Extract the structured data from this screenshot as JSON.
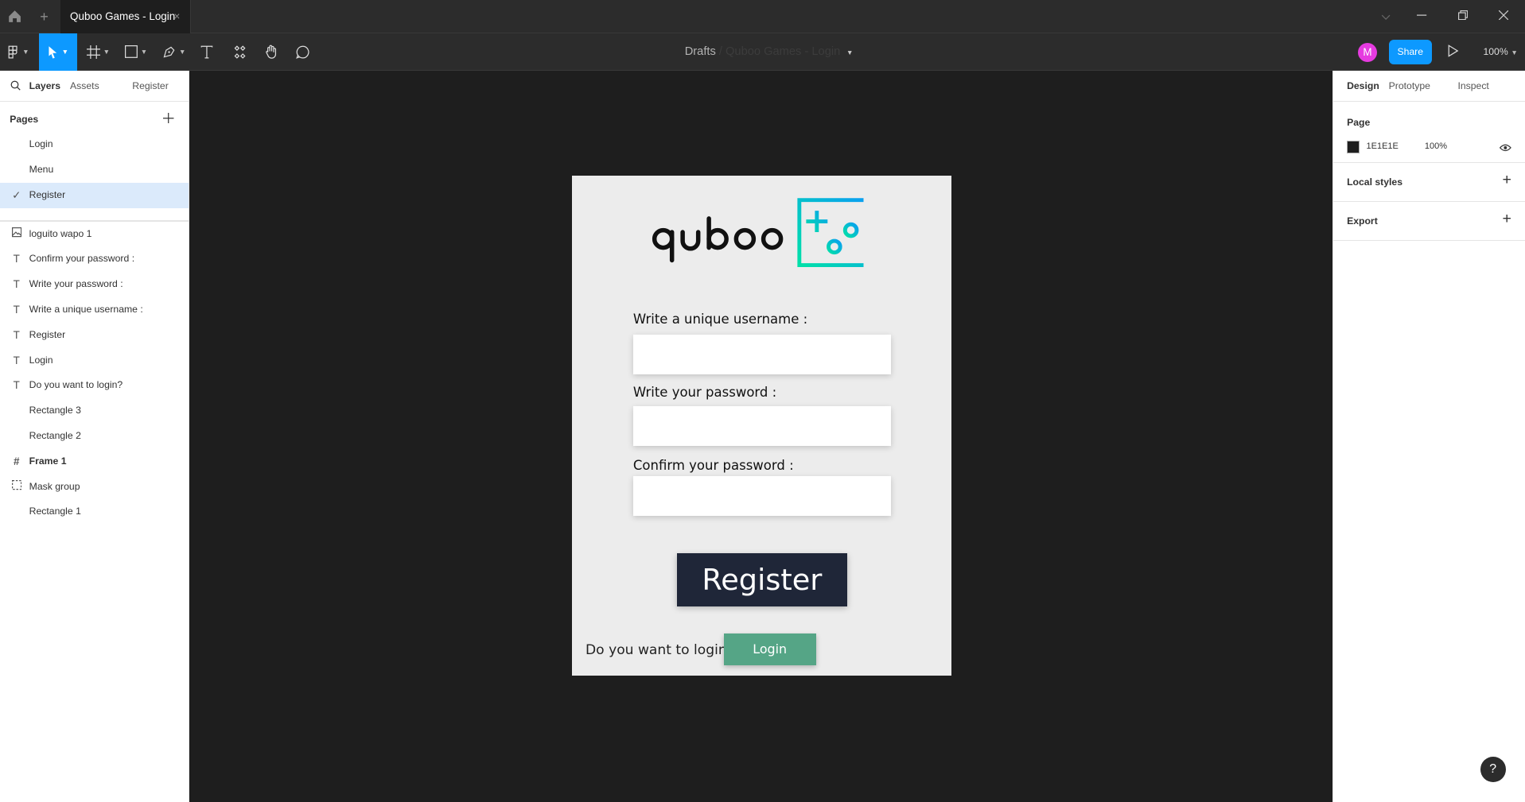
{
  "window": {
    "tab_title": "Quboo Games - Login",
    "tab_close": "×",
    "new_tab": "+"
  },
  "toolbar": {
    "breadcrumb_drafts": "Drafts",
    "breadcrumb_sep": "/",
    "breadcrumb_file": "Quboo Games",
    "breadcrumb_sep2": "-",
    "breadcrumb_page": "Login",
    "avatar_initial": "M",
    "share_label": "Share",
    "zoom_label": "100%",
    "accent": "#0d99ff"
  },
  "left_panel": {
    "tabs": [
      "Layers",
      "Assets",
      "Register"
    ],
    "pages_title": "Pages",
    "pages": [
      {
        "label": "Login",
        "selected": false
      },
      {
        "label": "Menu",
        "selected": false
      },
      {
        "label": "Register",
        "selected": true
      }
    ],
    "layers": [
      {
        "label": "loguito wapo 1",
        "icon": "image-icon"
      },
      {
        "label": "Confirm your password :",
        "icon": "text-icon"
      },
      {
        "label": "Write your password :",
        "icon": "text-icon"
      },
      {
        "label": "Write a unique username :",
        "icon": "text-icon"
      },
      {
        "label": "Register",
        "icon": "text-icon"
      },
      {
        "label": "Login",
        "icon": "text-icon"
      },
      {
        "label": "Do you want to login?",
        "icon": "text-icon"
      },
      {
        "label": "Rectangle 3",
        "icon": "rectangle-icon"
      },
      {
        "label": "Rectangle 2",
        "icon": "rectangle-icon"
      },
      {
        "label": "Frame 1",
        "icon": "frame-icon"
      },
      {
        "label": "Mask group",
        "icon": "mask-icon"
      },
      {
        "label": "Rectangle 1",
        "icon": "rectangle-icon"
      }
    ]
  },
  "right_panel": {
    "tabs": [
      "Design",
      "Prototype",
      "Inspect"
    ],
    "page_title": "Page",
    "page_color_hex": "1E1E1E",
    "page_opacity": "100%",
    "local_styles": "Local styles",
    "export": "Export",
    "help": "?"
  },
  "canvas": {
    "logo_text": "quboo",
    "username_label": "Write a unique username :",
    "password_label": "Write your password :",
    "confirm_label": "Confirm your password :",
    "register_button": "Register",
    "login_prompt": "Do you want to login?",
    "login_button": "Login",
    "frame_bg": "#ececec",
    "register_color": "#1f2638",
    "login_color": "#55a586"
  }
}
